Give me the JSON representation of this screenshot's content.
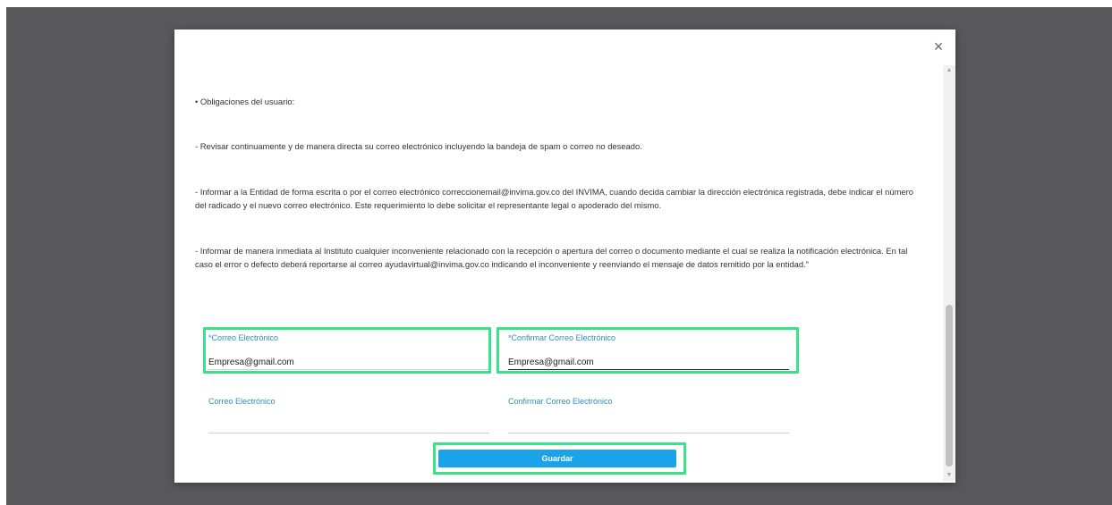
{
  "modal": {
    "close_symbol": "×",
    "paragraphs": [
      "• Obligaciones del usuario:",
      "- Revisar continuamente y de manera directa su correo electrónico incluyendo la bandeja de spam o correo no deseado.",
      "- Informar a la Entidad de forma escrita o por el correo electrónico correccionemail@invima.gov.co del INVIMA, cuando decida cambiar la dirección electrónica registrada, debe indicar el número del radicado y el nuevo correo electrónico. Este requerimiento lo debe solicitar el representante legal o apoderado del mismo.",
      "- Informar de manera inmediata al Instituto cualquier inconveniente relacionado con la recepción o apertura del correo o documento mediante el cual se realiza la notificación electrónica. En tal caso el error o defecto deberá reportarse al correo ayudavirtual@invima.gov.co indicando el inconveniente y reenviando el mensaje de datos remitido por la entidad.\""
    ],
    "form": {
      "email_1": {
        "label": "*Correo Electrónico",
        "value": "Empresa@gmail.com"
      },
      "confirm_1": {
        "label": "*Confirmar Correo Electrónico",
        "value": "Empresa@gmail.com"
      },
      "email_2": {
        "label": "Correo Electrónico",
        "value": ""
      },
      "confirm_2": {
        "label": "Confirmar Correo Electrónico",
        "value": ""
      }
    },
    "save_label": "Guardar"
  },
  "colors": {
    "backdrop": "#58585a",
    "label_blue": "#2e8fbf",
    "button_blue": "#1aa3e8",
    "highlight_green": "#3ae08a"
  }
}
